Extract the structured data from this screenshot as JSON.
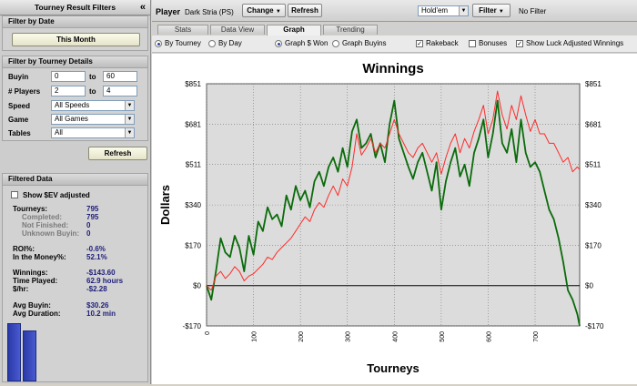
{
  "sidebar": {
    "title": "Tourney Result Filters",
    "collapse": "«",
    "filter_by_date": {
      "title": "Filter by Date",
      "button": "This Month"
    },
    "filter_by_tourney": {
      "title": "Filter by Tourney Details",
      "buyin_label": "Buyin",
      "buyin_min": "0",
      "to1": "to",
      "buyin_max": "60",
      "players_label": "# Players",
      "players_min": "2",
      "to2": "to",
      "players_max": "4",
      "speed_label": "Speed",
      "speed_value": "All Speeds",
      "game_label": "Game",
      "game_value": "All Games",
      "tables_label": "Tables",
      "tables_value": "All"
    },
    "refresh": "Refresh",
    "filtered": {
      "title": "Filtered Data",
      "show_sev": "Show $EV adjusted",
      "rows": [
        {
          "label": "Tourneys:",
          "value": "795"
        },
        {
          "label": "Completed:",
          "value": "795"
        },
        {
          "label": "Not Finished:",
          "value": "0"
        },
        {
          "label": "Unknown Buyin:",
          "value": "0"
        },
        {
          "label": "ROI%:",
          "value": "-0.6%"
        },
        {
          "label": "In the Money%:",
          "value": "52.1%"
        },
        {
          "label": "Winnings:",
          "value": "-$143.60"
        },
        {
          "label": "Time Played:",
          "value": "62.9 hours"
        },
        {
          "label": "$/hr:",
          "value": "-$2.28"
        },
        {
          "label": "Avg Buyin:",
          "value": "$30.26"
        },
        {
          "label": "Avg Duration:",
          "value": "10.2 min"
        }
      ]
    }
  },
  "toolbar": {
    "player_label": "Player",
    "player_name": "Dark Stria (PS)",
    "change": "Change",
    "refresh": "Refresh",
    "game": "Hold'em",
    "filter": "Filter",
    "filter_status": "No Filter"
  },
  "tabs": [
    "Stats",
    "Data View",
    "Graph",
    "Trending"
  ],
  "options": {
    "by_tourney": "By Tourney",
    "by_day": "By Day",
    "graph_won": "Graph $ Won",
    "graph_buyins": "Graph Buyins",
    "rakeback": "Rakeback",
    "bonuses": "Bonuses",
    "luck": "Show Luck Adjusted Winnings"
  },
  "colors": {
    "won_line": "#0a6b0a",
    "luck_line": "#ff2a2a",
    "plot_bg": "#dcdcdc"
  },
  "chart_data": {
    "type": "line",
    "title": "Winnings",
    "xlabel": "Tourneys",
    "ylabel": "Dollars",
    "xlim": [
      0,
      795
    ],
    "ylim": [
      -170,
      851
    ],
    "x_ticks": [
      0,
      100,
      200,
      300,
      400,
      500,
      600,
      700
    ],
    "y_ticks": [
      -170,
      0,
      170,
      340,
      511,
      681,
      851
    ],
    "y_tick_labels": [
      "-$170",
      "$0",
      "$170",
      "$340",
      "$511",
      "$681",
      "$851"
    ],
    "grid": true,
    "series": [
      {
        "name": "",
        "color": "#0a6b0a",
        "x": [
          0,
          10,
          20,
          30,
          40,
          50,
          60,
          70,
          80,
          90,
          100,
          110,
          120,
          130,
          140,
          150,
          160,
          170,
          180,
          190,
          200,
          210,
          220,
          230,
          240,
          250,
          260,
          270,
          280,
          290,
          300,
          310,
          320,
          330,
          340,
          350,
          360,
          370,
          380,
          390,
          400,
          410,
          420,
          430,
          440,
          450,
          460,
          470,
          480,
          490,
          500,
          510,
          520,
          530,
          540,
          550,
          560,
          570,
          580,
          590,
          600,
          610,
          620,
          630,
          640,
          650,
          660,
          670,
          680,
          690,
          700,
          710,
          720,
          730,
          740,
          750,
          760,
          770,
          780,
          790,
          795
        ],
        "y": [
          0,
          -60,
          60,
          200,
          140,
          120,
          210,
          160,
          60,
          210,
          130,
          270,
          230,
          330,
          280,
          300,
          250,
          380,
          320,
          420,
          360,
          400,
          330,
          440,
          480,
          420,
          500,
          540,
          480,
          580,
          500,
          650,
          700,
          580,
          600,
          640,
          540,
          600,
          520,
          680,
          780,
          620,
          560,
          500,
          450,
          520,
          560,
          480,
          400,
          520,
          320,
          440,
          520,
          580,
          460,
          510,
          420,
          560,
          620,
          700,
          540,
          640,
          780,
          600,
          560,
          660,
          520,
          700,
          560,
          500,
          520,
          480,
          400,
          320,
          280,
          200,
          100,
          -20,
          -60,
          -120,
          -170
        ]
      },
      {
        "name": "",
        "color": "#ff2a2a",
        "x": [
          0,
          10,
          20,
          30,
          40,
          50,
          60,
          70,
          80,
          90,
          100,
          110,
          120,
          130,
          140,
          150,
          160,
          170,
          180,
          190,
          200,
          210,
          220,
          230,
          240,
          250,
          260,
          270,
          280,
          290,
          300,
          310,
          320,
          330,
          340,
          350,
          360,
          370,
          380,
          390,
          400,
          410,
          420,
          430,
          440,
          450,
          460,
          470,
          480,
          490,
          500,
          510,
          520,
          530,
          540,
          550,
          560,
          570,
          580,
          590,
          600,
          610,
          620,
          630,
          640,
          650,
          660,
          670,
          680,
          690,
          700,
          710,
          720,
          730,
          740,
          750,
          760,
          770,
          780,
          790,
          795
        ],
        "y": [
          0,
          -20,
          40,
          60,
          30,
          50,
          80,
          60,
          20,
          40,
          50,
          70,
          90,
          120,
          110,
          140,
          160,
          180,
          200,
          230,
          260,
          290,
          270,
          320,
          350,
          330,
          380,
          420,
          380,
          450,
          420,
          500,
          640,
          550,
          580,
          620,
          560,
          600,
          580,
          640,
          700,
          640,
          600,
          560,
          540,
          580,
          600,
          560,
          520,
          560,
          470,
          540,
          600,
          640,
          560,
          620,
          580,
          650,
          700,
          760,
          640,
          700,
          820,
          720,
          660,
          760,
          700,
          800,
          720,
          650,
          700,
          640,
          640,
          600,
          600,
          560,
          520,
          540,
          480,
          500,
          490
        ]
      }
    ]
  }
}
